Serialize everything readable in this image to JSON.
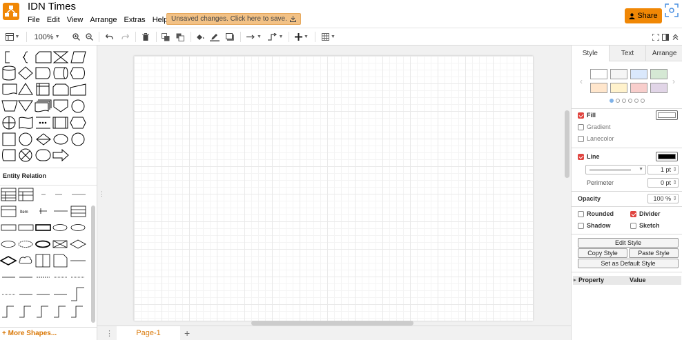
{
  "app": {
    "title": "IDN Times"
  },
  "menu": [
    "File",
    "Edit",
    "View",
    "Arrange",
    "Extras",
    "Help"
  ],
  "unsaved_notice": "Unsaved changes. Click here to save.",
  "share_label": "Share",
  "toolbar": {
    "zoom": "100%"
  },
  "left_panel": {
    "section_title": "Entity Relation",
    "er_item_label": "Item",
    "more_shapes": "+ More Shapes..."
  },
  "page_bar": {
    "page_tab": "Page-1"
  },
  "format_panel": {
    "tabs": [
      "Style",
      "Text",
      "Arrange"
    ],
    "swatch_colors": [
      "#ffffff",
      "#f5f5f5",
      "#dae8fc",
      "#d5e8d4",
      "#ffe6cc",
      "#fff2cc",
      "#f8cecc",
      "#e1d5e7"
    ],
    "fill_label": "Fill",
    "fill_color": "#ffffff",
    "gradient_label": "Gradient",
    "lanecolor_label": "Lanecolor",
    "line_label": "Line",
    "line_color": "#000000",
    "line_width": "1 pt",
    "perimeter_label": "Perimeter",
    "perimeter_value": "0 pt",
    "opacity_label": "Opacity",
    "opacity_value": "100 %",
    "rounded_label": "Rounded",
    "divider_label": "Divider",
    "shadow_label": "Shadow",
    "sketch_label": "Sketch",
    "edit_style": "Edit Style",
    "copy_style": "Copy Style",
    "paste_style": "Paste Style",
    "set_default_style": "Set as Default Style",
    "property_header": "Property",
    "value_header": "Value"
  },
  "colors": {
    "accent": "#f08705",
    "page_tab_text": "#d97706",
    "checkbox_on": "#e0443f"
  }
}
